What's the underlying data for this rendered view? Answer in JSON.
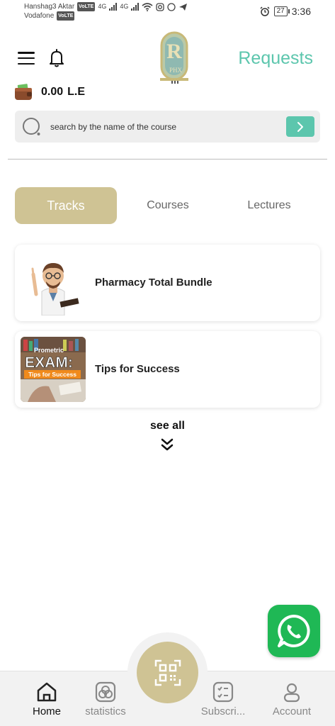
{
  "status_bar": {
    "carrier1": "Hanshag3 Aktar",
    "carrier2": "Vodafone",
    "volte": "VoLTE",
    "net": "4G",
    "battery": "27",
    "time": "3:36"
  },
  "header": {
    "requests_label": "Requests",
    "balance_amount": "0.00",
    "balance_currency": "L.E"
  },
  "search": {
    "placeholder": "search by the name of the course"
  },
  "tabs": [
    {
      "label": "Tracks",
      "active": true
    },
    {
      "label": "Courses",
      "active": false
    },
    {
      "label": "Lectures",
      "active": false
    }
  ],
  "cards": [
    {
      "title": "Pharmacy Total Bundle",
      "thumb": "pharmacist-cartoon"
    },
    {
      "title": "Tips for Success",
      "thumb": "prometric-exam",
      "thumb_text": {
        "line1": "Prometric",
        "line2": "EXAM:",
        "line3": "Tips for Success"
      }
    }
  ],
  "see_all_label": "see all",
  "bottom_nav": {
    "home": "Home",
    "statistics": "statistics",
    "subscriptions": "Subscri...",
    "account": "Account"
  },
  "colors": {
    "accent_gold": "#cfc394",
    "accent_teal": "#5cc6ad",
    "whatsapp_green": "#1fb855"
  },
  "icons": [
    "menu-icon",
    "bell-icon",
    "wallet-icon",
    "search-icon",
    "chevron-right-icon",
    "double-chevron-down-icon",
    "whatsapp-icon",
    "qr-code-icon",
    "home-icon",
    "statistics-icon",
    "subscriptions-icon",
    "account-icon"
  ]
}
